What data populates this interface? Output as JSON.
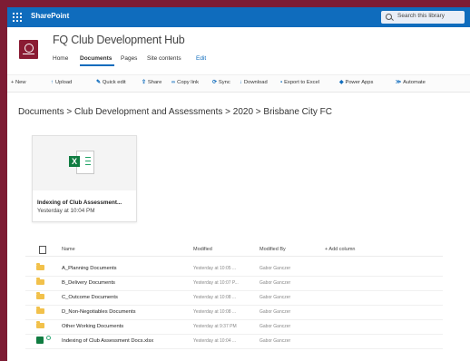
{
  "suitebar": {
    "brand": "SharePoint",
    "search_placeholder": "Search this library"
  },
  "site": {
    "title": "FQ Club Development Hub",
    "nav": [
      "Home",
      "Documents",
      "Pages",
      "Site contents",
      "Edit"
    ],
    "active_nav": "Documents"
  },
  "commands": [
    "+ New",
    "Upload",
    "Quick edit",
    "Share",
    "Copy link",
    "Sync",
    "Download",
    "Export to Excel",
    "Power Apps",
    "Automate"
  ],
  "breadcrumb": "Documents > Club Development and Assessments > 2020 > Brisbane City FC",
  "tile": {
    "name": "Indexing of Club Assessment...",
    "time": "Yesterday at 10:04 PM"
  },
  "list": {
    "headers": {
      "name": "Name",
      "modified": "Modified",
      "modified_by": "Modified By",
      "add_column": "+ Add column"
    },
    "rows": [
      {
        "name": "A_Planning Documents",
        "modified": "Yesterday at 10:05 ...",
        "by": "Gabor Ganczer",
        "type": "folder"
      },
      {
        "name": "B_Delivery Documents",
        "modified": "Yesterday at 10:07 P...",
        "by": "Gabor Ganczer",
        "type": "folder"
      },
      {
        "name": "C_Outcome Documents",
        "modified": "Yesterday at 10:08 ...",
        "by": "Gabor Ganczer",
        "type": "folder"
      },
      {
        "name": "D_Non-Negotiables Documents",
        "modified": "Yesterday at 10:08 ...",
        "by": "Gabor Ganczer",
        "type": "folder"
      },
      {
        "name": "Other Working Documents",
        "modified": "Yesterday at 9:37 PM",
        "by": "Gabor Ganczer",
        "type": "folder"
      },
      {
        "name": "Indexing of Club Assessment Docs.xlsx",
        "modified": "Yesterday at 10:04 ...",
        "by": "Gabor Ganczer",
        "type": "xlsx"
      }
    ]
  },
  "colors": {
    "suitebar": "#0f6cbd",
    "background": "#7d1c34",
    "folder": "#f2c14b",
    "excel": "#107c41"
  }
}
